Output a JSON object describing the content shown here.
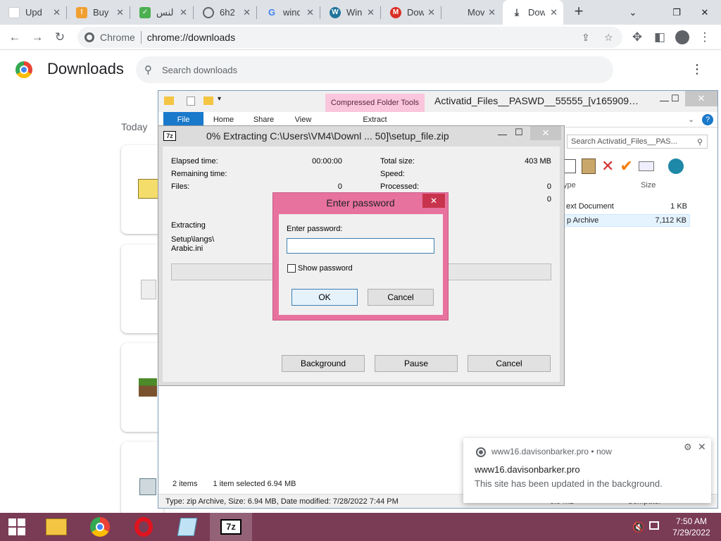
{
  "tabs": [
    {
      "label": "Upd",
      "favicon": "windows-update-icon",
      "color": "#ffffff"
    },
    {
      "label": "Buy",
      "favicon": "download-shield-icon",
      "color": "#f0a030"
    },
    {
      "label": "النس",
      "favicon": "green-check-icon",
      "color": "#4caf50"
    },
    {
      "label": "6h2",
      "favicon": "globe-icon",
      "color": "#5f6368"
    },
    {
      "label": "wind",
      "favicon": "google-icon",
      "color": "#4285f4"
    },
    {
      "label": "Win",
      "favicon": "wordpress-icon",
      "color": "#21759b"
    },
    {
      "label": "Dow",
      "favicon": "red-m-icon",
      "color": "#d93025"
    },
    {
      "label": "Mov",
      "favicon": "blank-icon",
      "color": "#ffffff"
    },
    {
      "label": "Dow",
      "favicon": "download-icon",
      "color": "#5f6368"
    }
  ],
  "omnibox": {
    "chip": "Chrome",
    "url": "chrome://downloads"
  },
  "downloads": {
    "title": "Downloads",
    "search_placeholder": "Search downloads",
    "section": "Today"
  },
  "explorer": {
    "context_tab": "Compressed Folder Tools",
    "title": "Activatid_Files__PASWD__55555_[v165909…",
    "ribbon_tabs": [
      "File",
      "Home",
      "Share",
      "View",
      "Extract"
    ],
    "search_placeholder": "Search Activatid_Files__PAS...",
    "columns": {
      "type": "ype",
      "size": "Size"
    },
    "rows": [
      {
        "type": "ext Document",
        "size": "1 KB"
      },
      {
        "type": "p Archive",
        "size": "7,112 KB"
      }
    ],
    "status_items": "2 items",
    "status_selected": "1 item selected  6.94 MB",
    "details": "Type: zip Archive, Size: 6.94 MB, Date modified: 7/28/2022 7:44 PM",
    "bottom_partial_size": "6.9 MB",
    "bottom_partial_loc": "Computer"
  },
  "zip": {
    "logo": "7z",
    "title": "0% Extracting C:\\Users\\VM4\\Downl ... 50]\\setup_file.zip",
    "elapsed_label": "Elapsed time:",
    "elapsed_value": "00:00:00",
    "remaining_label": "Remaining time:",
    "files_label": "Files:",
    "files_value": "0",
    "total_label": "Total size:",
    "total_value": "403 MB",
    "speed_label": "Speed:",
    "processed_label": "Processed:",
    "processed_value": "0",
    "extra_value": "0",
    "extracting_label": "Extracting",
    "current_file": "Setup\\langs\\\nArabic.ini",
    "progress": 0,
    "btn_background": "Background",
    "btn_pause": "Pause",
    "btn_cancel": "Cancel"
  },
  "password_dialog": {
    "title": "Enter password",
    "label": "Enter password:",
    "value": "",
    "show_label": "Show password",
    "ok": "OK",
    "cancel": "Cancel"
  },
  "notification": {
    "source": "www16.davisonbarker.pro  •  now",
    "title": "www16.davisonbarker.pro",
    "message": "This site has been updated in the background."
  },
  "taskbar": {
    "apps": [
      "file-explorer-icon",
      "chrome-icon",
      "opera-icon",
      "notepad-icon",
      "7zip-icon"
    ],
    "time": "7:50 AM",
    "date": "7/29/2022"
  }
}
